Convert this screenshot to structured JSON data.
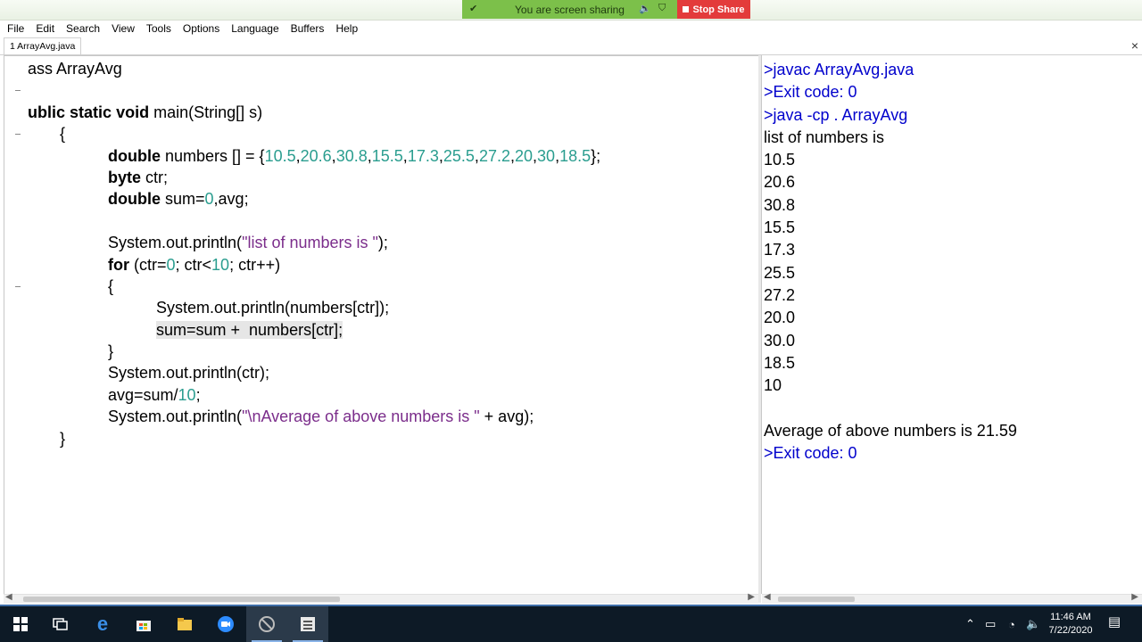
{
  "share_bar": {
    "status_text": "You are screen sharing",
    "stop_label": "Stop Share",
    "stop_color": "#e33b3b",
    "pill_color": "#7cc04a"
  },
  "menu": [
    "File",
    "Edit",
    "Search",
    "View",
    "Tools",
    "Options",
    "Language",
    "Buffers",
    "Help"
  ],
  "tab": {
    "label": "1 ArrayAvg.java",
    "close_icon": "×"
  },
  "editor": {
    "lines": [
      "ass ArrayAvg",
      "",
      "ublic static void main(String[] s)",
      "{",
      "double numbers [] = {10.5,20.6,30.8,15.5,17.3,25.5,27.2,20,30,18.5};",
      "byte ctr;",
      "double sum=0,avg;",
      "",
      "System.out.println(\"list of numbers is \");",
      "for (ctr=0; ctr<10; ctr++)",
      "{",
      "System.out.println(numbers[ctr]);",
      "sum=sum +  numbers[ctr];",
      "}",
      "System.out.println(ctr);",
      "avg=sum/10;",
      "System.out.println(\"\\nAverage of above numbers is \" + avg);",
      "}"
    ]
  },
  "output": {
    "lines": [
      ">javac ArrayAvg.java",
      ">Exit code: 0",
      ">java -cp . ArrayAvg",
      "list of numbers is",
      "10.5",
      "20.6",
      "30.8",
      "15.5",
      "17.3",
      "25.5",
      "27.2",
      "20.0",
      "30.0",
      "18.5",
      "10",
      "",
      "Average of above numbers is 21.59",
      ">Exit code: 0"
    ]
  },
  "taskbar": {
    "time": "11:46 AM",
    "date": "7/22/2020"
  },
  "colors": {
    "keyword": "#000000",
    "number": "#2a9d8f",
    "string": "#7b2d8b",
    "command": "#0000cc"
  }
}
